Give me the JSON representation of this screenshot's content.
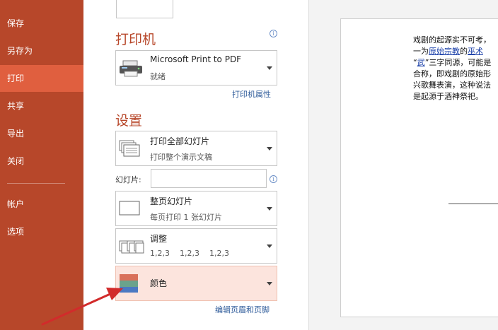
{
  "sidebar": {
    "items": [
      {
        "label": "保存",
        "active": false
      },
      {
        "label": "另存为",
        "active": false
      },
      {
        "label": "打印",
        "active": true
      },
      {
        "label": "共享",
        "active": false
      },
      {
        "label": "导出",
        "active": false
      },
      {
        "label": "关闭",
        "active": false
      },
      {
        "label": "帐户",
        "active": false
      },
      {
        "label": "选项",
        "active": false
      }
    ]
  },
  "printer": {
    "section_title": "打印机",
    "name": "Microsoft Print to PDF",
    "status": "就绪",
    "properties_link": "打印机属性"
  },
  "settings": {
    "section_title": "设置",
    "range": {
      "title": "打印全部幻灯片",
      "subtitle": "打印整个演示文稿"
    },
    "slides_label": "幻灯片:",
    "slides_value": "",
    "layout": {
      "title": "整页幻灯片",
      "subtitle": "每页打印 1 张幻灯片"
    },
    "collate": {
      "title": "调整",
      "subtitle": "1,2,3    1,2,3    1,2,3"
    },
    "color": {
      "title": "颜色"
    },
    "header_footer_link": "编辑页眉和页脚"
  },
  "preview": {
    "lines": [
      {
        "text": "戏剧的起源实不可考，"
      },
      {
        "pre": "一为",
        "u1": "原始宗教",
        "mid": "的",
        "u2": "巫术"
      },
      {
        "pre": "“",
        "u1": "武",
        "post": "”三字同源，可能是"
      },
      {
        "text": "合称，即戏剧的原始形"
      },
      {
        "text": "兴歌舞表演，这种说法"
      },
      {
        "text": "是起源于酒神祭祀。"
      }
    ]
  },
  "colors": {
    "sidebar": "#b7472a",
    "sidebar_active": "#e05f3f",
    "accent": "#b7472a",
    "link": "#2e5b9a",
    "annotation": "#d22b2b"
  }
}
